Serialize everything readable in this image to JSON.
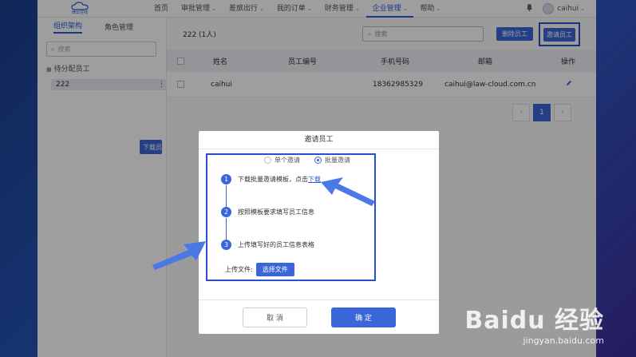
{
  "logo": {
    "text": "律云在线"
  },
  "nav": [
    {
      "label": "首页",
      "caret": false,
      "active": false
    },
    {
      "label": "审批管理",
      "caret": true,
      "active": false
    },
    {
      "label": "差旅出行",
      "caret": true,
      "active": false
    },
    {
      "label": "我的订单",
      "caret": true,
      "active": false
    },
    {
      "label": "财务管理",
      "caret": true,
      "active": false
    },
    {
      "label": "企业管理",
      "caret": true,
      "active": true
    },
    {
      "label": "帮助",
      "caret": true,
      "active": false
    }
  ],
  "user": {
    "name": "caihui"
  },
  "sidebar": {
    "tabs": [
      "组织架构",
      "角色管理"
    ],
    "search_placeholder": "搜索",
    "group_label": "待分配员工",
    "dept_label": "222"
  },
  "main": {
    "title": "222 (1人)",
    "search_placeholder": "搜索",
    "delete_button": "删除员工",
    "invite_button": "邀请员工",
    "columns": [
      "姓名",
      "员工编号",
      "手机号码",
      "邮箱",
      "操作"
    ],
    "rows": [
      {
        "name": "caihui",
        "emp_no": "",
        "phone": "18362985329",
        "email": "caihui@law-cloud.com.cn"
      }
    ],
    "pagination": {
      "current": "1"
    },
    "download_button": "下载员工"
  },
  "modal": {
    "title": "邀请员工",
    "radio_single": "单个邀请",
    "radio_batch": "批量邀请",
    "steps": [
      {
        "num": "1",
        "text": "下载批量邀请模板，点击",
        "link": "下载"
      },
      {
        "num": "2",
        "text": "按照模板要求填写员工信息"
      },
      {
        "num": "3",
        "text": "上传填写好的员工信息表格"
      }
    ],
    "upload_label": "上传文件:",
    "choose_file": "选择文件",
    "cancel": "取 消",
    "confirm": "确 定"
  },
  "watermark": {
    "top": "Baidu 经验",
    "bottom": "jingyan.baidu.com"
  },
  "colors": {
    "accent": "#3b66d9",
    "highlight_border": "#2b4ed3",
    "arrow": "#4a78e6"
  }
}
